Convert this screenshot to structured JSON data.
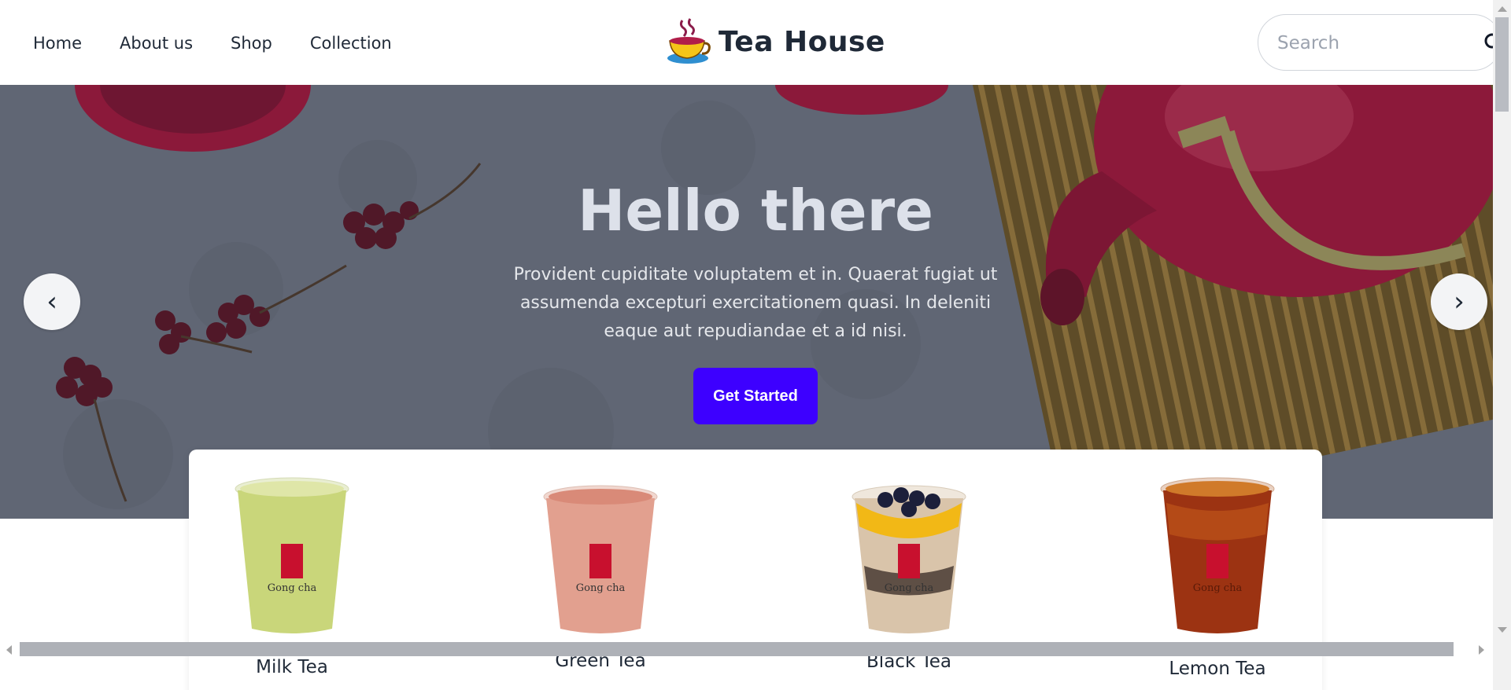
{
  "header": {
    "nav": [
      "Home",
      "About us",
      "Shop",
      "Collection"
    ],
    "brand_title": "Tea House",
    "search_placeholder": "Search"
  },
  "hero": {
    "title": "Hello there",
    "description": "Provident cupiditate voluptatem et in. Quaerat fugiat ut assumenda excepturi exercitationem quasi. In deleniti eaque aut repudiandae et a id nisi.",
    "cta_label": "Get Started",
    "prev_label": "‹",
    "next_label": "›"
  },
  "products": [
    {
      "name": "Milk Tea",
      "cup_color": "#c9d67a",
      "brand": "Gong cha"
    },
    {
      "name": "Green Tea",
      "cup_color": "#e2a08f",
      "brand": "Gong cha"
    },
    {
      "name": "Black Tea",
      "cup_color": "#d9c4aa",
      "brand": "Gong cha"
    },
    {
      "name": "Lemon Tea",
      "cup_color": "#9c3312",
      "brand": "Gong cha"
    }
  ],
  "colors": {
    "accent": "#3d00ff",
    "hero_bg": "#6e7581",
    "teapot": "#b0163a"
  }
}
